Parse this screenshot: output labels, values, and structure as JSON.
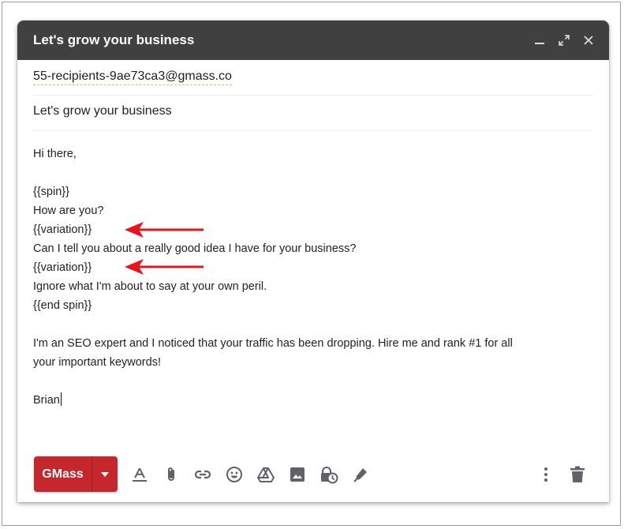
{
  "window": {
    "title": "Let's grow your business",
    "minimize_icon": "minimize-icon",
    "expand_icon": "expand-icon",
    "close_icon": "close-icon"
  },
  "recipients": {
    "to": "55-recipients-9ae73ca3@gmass.co"
  },
  "subject": "Let's grow your business",
  "body": {
    "lines": [
      "Hi there,",
      "",
      "{{spin}}",
      "How are you?",
      "{{variation}}",
      "Can I tell you about a really good idea I have for your business?",
      "{{variation}}",
      "Ignore what I'm about to say at your own peril.",
      "{{end spin}}",
      "",
      "I'm an SEO expert and I noticed that your traffic has been dropping. Hire me and rank #1 for all",
      "your important keywords!",
      "",
      "Brian"
    ]
  },
  "annotations": {
    "arrow_color": "#e8141b"
  },
  "toolbar": {
    "send_label": "GMass",
    "send_color": "#c5272d",
    "icons": [
      "text-format-icon",
      "attach-icon",
      "link-icon",
      "emoji-icon",
      "drive-icon",
      "image-icon",
      "confidential-icon",
      "signature-icon"
    ],
    "right_icons": [
      "more-options-icon",
      "trash-icon"
    ]
  }
}
